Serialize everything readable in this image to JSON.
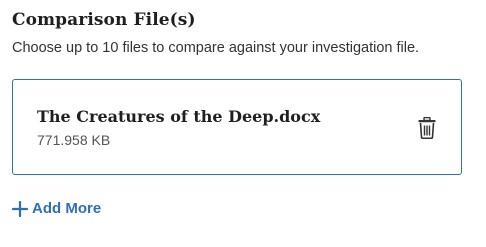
{
  "section": {
    "title": "Comparison File(s)",
    "description": "Choose up to 10 files to compare against your investigation file."
  },
  "file": {
    "name": "The Creatures of the Deep.docx",
    "size": "771.958 KB",
    "delete_icon": "trash-icon"
  },
  "actions": {
    "add_more_label": "Add More",
    "add_more_icon": "plus-icon"
  },
  "colors": {
    "accent": "#2f6fb3",
    "card_border": "#2f72b8",
    "text": "#1f1f1f",
    "muted_text": "#555555"
  }
}
